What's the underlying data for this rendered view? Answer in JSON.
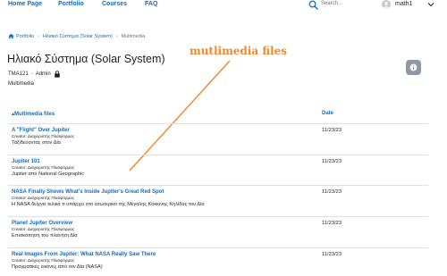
{
  "nav": {
    "items": [
      {
        "label": "Home Page"
      },
      {
        "label": "Portfolio"
      },
      {
        "label": "Courses"
      },
      {
        "label": "FAQ"
      }
    ],
    "search_placeholder": "Search...",
    "user_name": "math1"
  },
  "breadcrumb": {
    "items": [
      "Portfolio",
      "Ηλιακό Σύστημα (Solar System)",
      "Multimedia"
    ]
  },
  "header": {
    "title": "Ηλιακό Σύστημα (Solar System)",
    "code": "TMA121",
    "owner": "Admin",
    "type": "Multimedia"
  },
  "annotation": {
    "text": "mutlimedia files",
    "color": "#f4862a"
  },
  "table": {
    "col_name": "Multimedia files",
    "col_date": "Date",
    "rows": [
      {
        "title": "A \"Flight\" Over Jupiter",
        "creator": "Creator: Διαχειριστής Πλατφόρμας",
        "description": "Ταξιδεύοντας στον Δία",
        "date": "11/23/23"
      },
      {
        "title": "Jupiter 101",
        "creator": "Creator: Διαχειριστής Πλατφόρμας",
        "description": "Jupiter από National Geographic",
        "date": "11/23/23"
      },
      {
        "title": "NASA Finally Shows What's Inside Jupiter's Great Red Spot",
        "creator": "Creator: Διαχειριστής Πλατφόρμας",
        "description": "Η NASA δείχνει τελικά τι υπάρχει στο εσωτερικό της Μεγάλης Κόκκινης Κηλίδας του Δία",
        "date": "11/23/23"
      },
      {
        "title": "Planet Jupiter Overview",
        "creator": "Creator: Διαχειριστής Πλατφόρμας",
        "description": "Επισκόπηση του πλανήτη Δία",
        "date": "11/23/23"
      },
      {
        "title": "Real Images From Jupiter: What NASA Really Saw There",
        "creator": "Creator: Διαχειριστής Πλατφόρμας",
        "description": "Πραγματικές εικόνες από τον Δία (NASA)",
        "date": "11/23/23"
      }
    ]
  }
}
